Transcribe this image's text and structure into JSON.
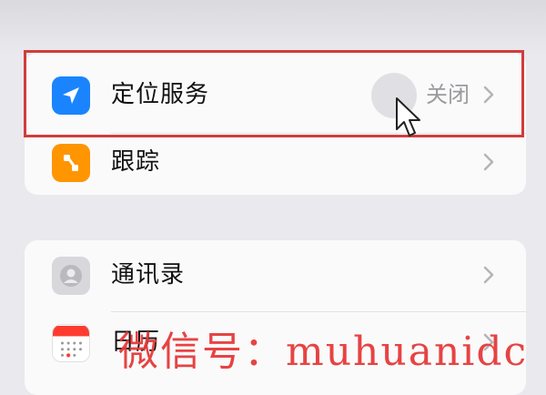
{
  "privacy_list": {
    "group1": [
      {
        "label": "定位服务",
        "value": "关闭",
        "icon": "location-arrow-icon",
        "icon_color": "#1a84ff"
      },
      {
        "label": "跟踪",
        "icon": "tracking-icon",
        "icon_color": "#ff9500"
      }
    ],
    "group2": [
      {
        "label": "通讯录",
        "icon": "contacts-icon",
        "icon_color": "#c7c7cc"
      },
      {
        "label": "日历",
        "icon": "calendar-icon",
        "icon_color": "#ff3b30"
      }
    ]
  },
  "annotation": {
    "highlight_color": "#d23c3c"
  },
  "watermark": {
    "text": "微信号：muhuanidc",
    "color": "#e63a3a"
  }
}
